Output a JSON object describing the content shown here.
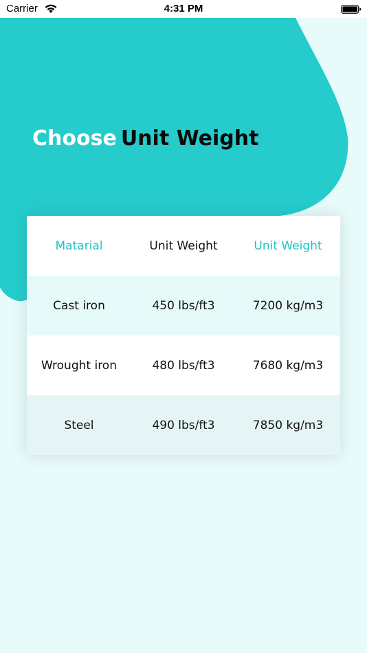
{
  "status_bar": {
    "carrier": "Carrier",
    "time": "4:31 PM"
  },
  "heading": {
    "light_part": "Choose",
    "dark_part": "Unit Weight"
  },
  "table": {
    "headers": [
      "Matarial",
      "Unit Weight",
      "Unit Weight"
    ],
    "rows": [
      [
        "Cast iron",
        "450 lbs/ft3",
        "7200 kg/m3"
      ],
      [
        "Wrought iron",
        "480 lbs/ft3",
        "7680 kg/m3"
      ],
      [
        "Steel",
        "490 lbs/ft3",
        "7850 kg/m3"
      ]
    ]
  },
  "colors": {
    "accent": "#26cccc",
    "background": "#e8fbfb",
    "header_accent_text": "#20c4c4"
  },
  "icons": [
    "wifi-icon",
    "battery-icon"
  ]
}
